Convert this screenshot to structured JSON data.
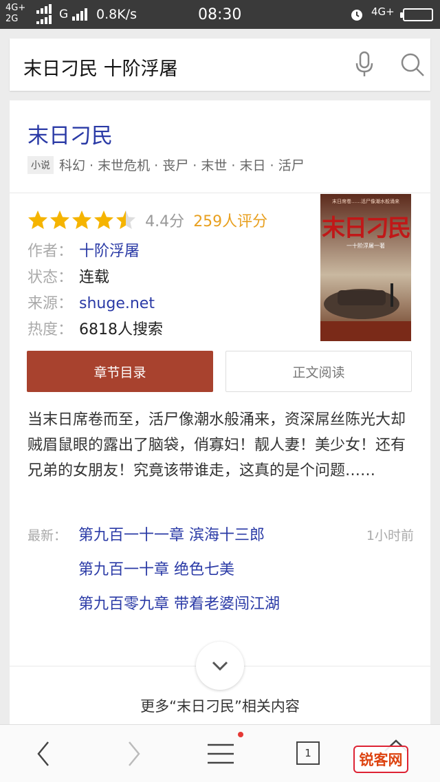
{
  "status_bar": {
    "net_top": "4G+",
    "net_bottom": "2G",
    "net_g": "G",
    "speed": "0.8K/s",
    "time": "08:30",
    "net_right": "4G+"
  },
  "search": {
    "query": "末日刁民 十阶浮屠",
    "icons": [
      "mic-icon",
      "search-icon"
    ]
  },
  "book": {
    "title": "末日刁民",
    "tag_badge": "小说",
    "tags": "科幻 · 末世危机 · 丧尸 · 末世 · 末日 · 活尸",
    "rating_value": 4.4,
    "rating_stars_max": 5,
    "score": "4.4分",
    "rating_count": "259人评分",
    "author_label": "作者：",
    "author": "十阶浮屠",
    "status_label": "状态：",
    "status": "连载",
    "source_label": "来源：",
    "source": "shuge.net",
    "heat_label": "热度：",
    "heat": "6818人搜索",
    "cover": {
      "title": "末日刁民",
      "subtitle": "一十阶浮屠一著",
      "top_text": "末日席卷……活尸像潮水般涌来"
    },
    "btn_catalog": "章节目录",
    "btn_read": "正文阅读",
    "description": "当末日席卷而至，活尸像潮水般涌来，资深屌丝陈光大却贼眉鼠眼的露出了脑袋，俏寡妇！靓人妻！美少女！还有兄弟的女朋友！究竟该带谁走，这真的是个问题……",
    "latest_label": "最新：",
    "latest_time": "1小时前",
    "chapters": [
      "第九百一十一章 滨海十三郎",
      "第九百一十章 绝色七美",
      "第九百零九章 带着老婆闯江湖"
    ],
    "more_related": "更多“末日刁民”相关内容"
  },
  "bottom_nav": {
    "tab_count": "1",
    "watermark": "锐客网",
    "icons": [
      "back-icon",
      "forward-icon",
      "menu-icon",
      "tabs-icon",
      "home-icon"
    ]
  },
  "colors": {
    "link": "#2a3aa6",
    "primary_button": "#a8422e",
    "rating_count": "#e8a020",
    "star": "#f5b400",
    "status_bar": "#3a3a3a"
  }
}
